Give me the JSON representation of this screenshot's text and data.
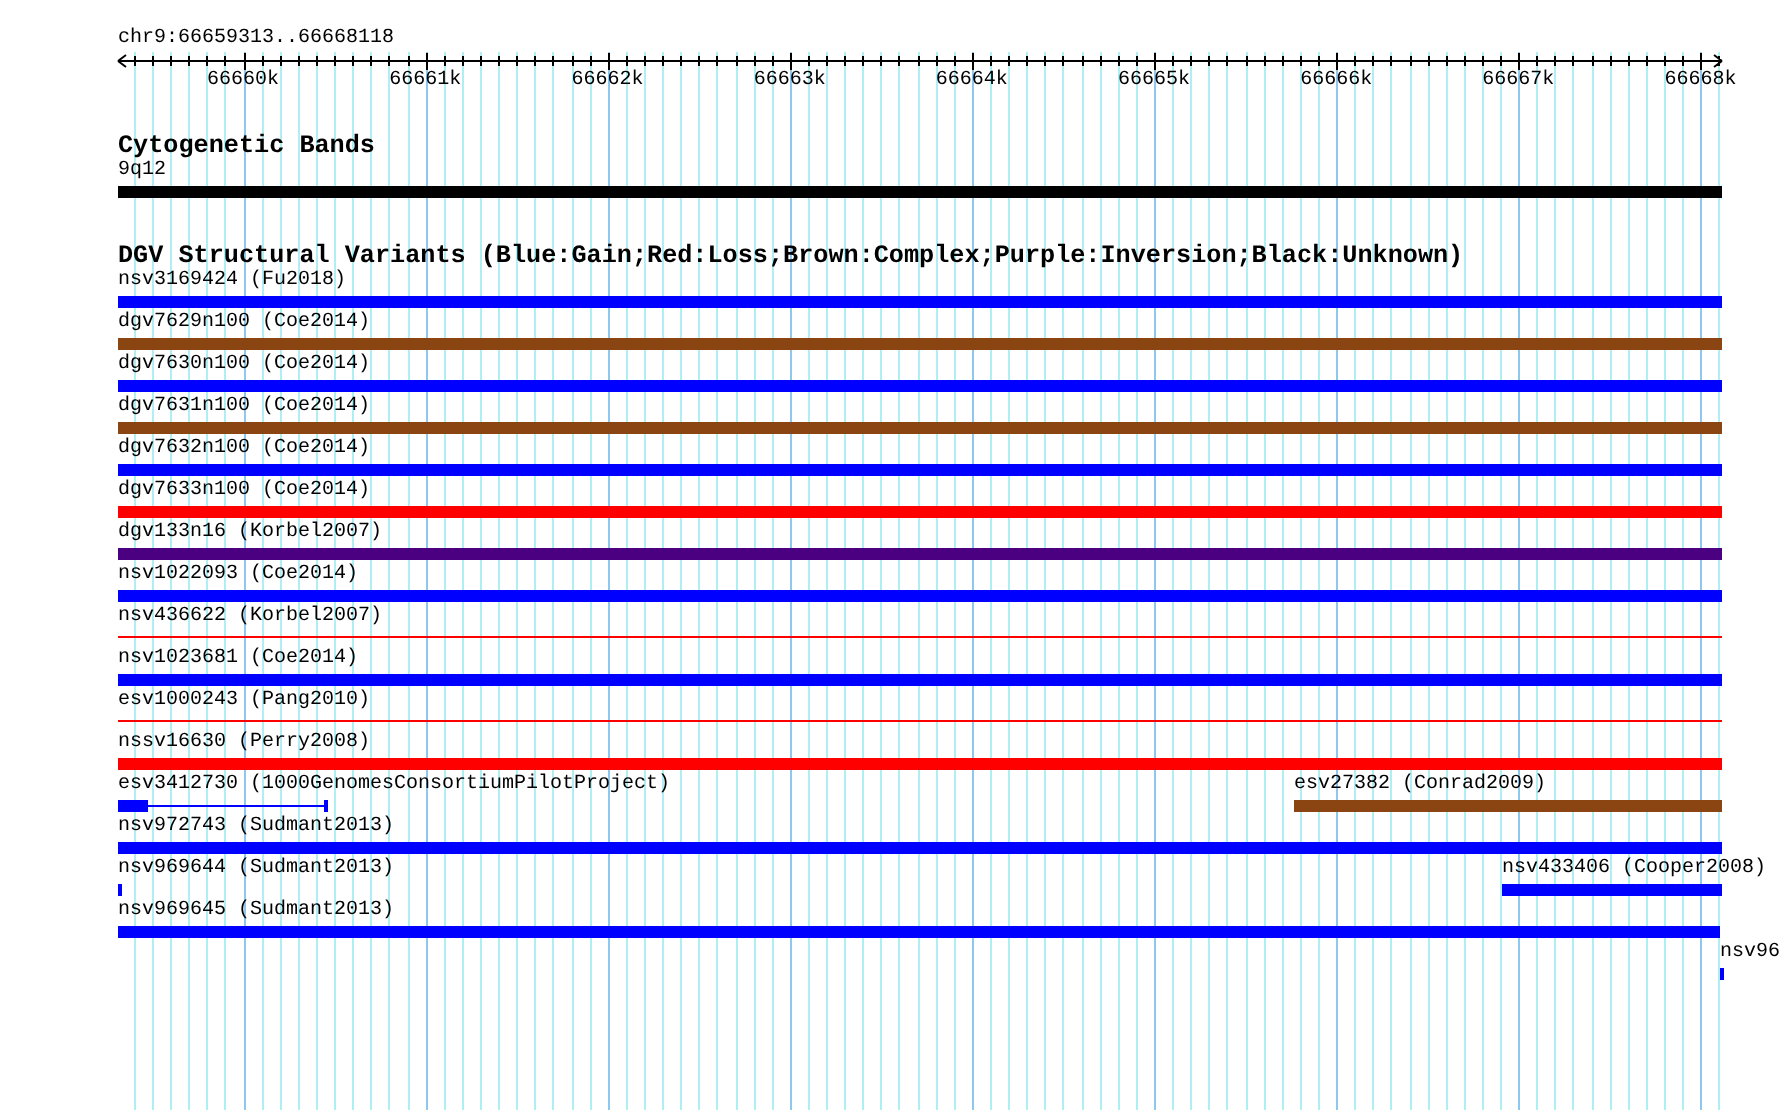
{
  "ruler": {
    "location": "chr9:66659313..66668118",
    "ticks": [
      "66660k",
      "66661k",
      "66662k",
      "66663k",
      "66664k",
      "66665k",
      "66666k",
      "66667k",
      "66668k"
    ]
  },
  "tracks": [
    {
      "title": "Cytogenetic Bands",
      "rows": [
        [
          {
            "label": "9q12",
            "kind": "block",
            "color": "#000000"
          }
        ]
      ]
    },
    {
      "title": "DGV Structural Variants (Blue:Gain;Red:Loss;Brown:Complex;Purple:Inversion;Black:Unknown)",
      "rows": [
        [
          {
            "label": "nsv3169424 (Fu2018)",
            "kind": "block",
            "color": "#0000ff"
          }
        ],
        [
          {
            "label": "dgv7629n100 (Coe2014)",
            "kind": "block",
            "color": "#8b4513"
          }
        ],
        [
          {
            "label": "dgv7630n100 (Coe2014)",
            "kind": "block",
            "color": "#0000ff"
          }
        ],
        [
          {
            "label": "dgv7631n100 (Coe2014)",
            "kind": "block",
            "color": "#8b4513"
          }
        ],
        [
          {
            "label": "dgv7632n100 (Coe2014)",
            "kind": "block",
            "color": "#0000ff"
          }
        ],
        [
          {
            "label": "dgv7633n100 (Coe2014)",
            "kind": "block",
            "color": "#ff0000"
          }
        ],
        [
          {
            "label": "dgv133n16 (Korbel2007)",
            "kind": "block",
            "color": "#4b0082"
          }
        ],
        [
          {
            "label": "nsv1022093 (Coe2014)",
            "kind": "block",
            "color": "#0000ff"
          }
        ],
        [
          {
            "label": "nsv436622 (Korbel2007)",
            "kind": "line",
            "color": "#ff0000"
          }
        ],
        [
          {
            "label": "nsv1023681 (Coe2014)",
            "kind": "block",
            "color": "#0000ff"
          }
        ],
        [
          {
            "label": "esv1000243 (Pang2010)",
            "kind": "line",
            "color": "#ff0000"
          }
        ],
        [
          {
            "label": "nssv16630 (Perry2008)",
            "kind": "block",
            "color": "#ff0000"
          }
        ],
        [
          {
            "label": "esv3412730 (1000GenomesConsortiumPilotProject)",
            "kind": "split",
            "color": "#0000ff"
          },
          {
            "label": "esv27382 (Conrad2009)",
            "kind": "block",
            "color": "#8b4513"
          }
        ],
        [
          {
            "label": "nsv972743 (Sudmant2013)",
            "kind": "block",
            "color": "#0000ff"
          }
        ],
        [
          {
            "label": "nsv969644 (Sudmant2013)",
            "kind": "block",
            "color": "#0000ff"
          },
          {
            "label": "nsv433406 (Cooper2008)",
            "kind": "block",
            "color": "#0000ff"
          }
        ],
        [
          {
            "label": "nsv969645 (Sudmant2013)",
            "kind": "block",
            "color": "#0000ff"
          }
        ],
        [
          {
            "label": "nsv96",
            "kind": "block",
            "color": "#0000ff"
          }
        ]
      ]
    }
  ]
}
